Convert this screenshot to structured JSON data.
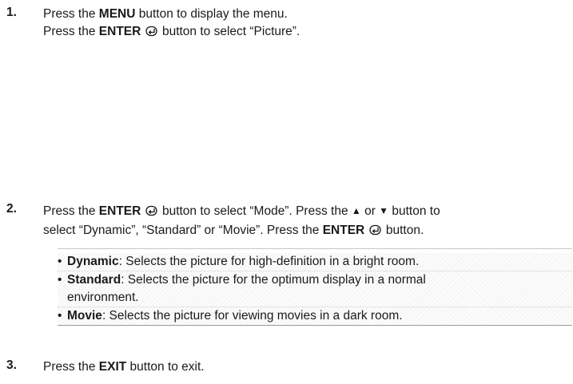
{
  "step1": {
    "number": "1.",
    "line1_pre": "Press the ",
    "line1_bold": "MENU",
    "line1_post": " button to display the menu.",
    "line2_pre": "Press the ",
    "line2_bold": "ENTER",
    "line2_post": " button to select “Picture”."
  },
  "step2": {
    "number": "2.",
    "a_pre": "Press the ",
    "a_bold": "ENTER",
    "a_mid": " button to select “Mode”. Press the ",
    "a_up": "▲",
    "a_or": " or ",
    "a_down": "▼",
    "a_post": " button to",
    "b_pre": "select “Dynamic”, “Standard” or “Movie”. Press the ",
    "b_bold": "ENTER",
    "b_post": " button."
  },
  "notes": [
    {
      "bullet": "•",
      "term": "Dynamic",
      "desc": ": Selects the picture for high-definition in a bright room.",
      "desc2": ""
    },
    {
      "bullet": "•",
      "term": "Standard",
      "desc": ": Selects the picture for the optimum display in a normal",
      "desc2": "environment."
    },
    {
      "bullet": "•",
      "term": "Movie",
      "desc": ": Selects the picture for viewing movies in a dark room.",
      "desc2": ""
    }
  ],
  "step3": {
    "number": "3.",
    "pre": "Press the ",
    "bold": "EXIT",
    "post": " button to exit."
  },
  "icons": {
    "enter": "enter-icon",
    "up": "up-triangle-icon",
    "down": "down-triangle-icon"
  }
}
